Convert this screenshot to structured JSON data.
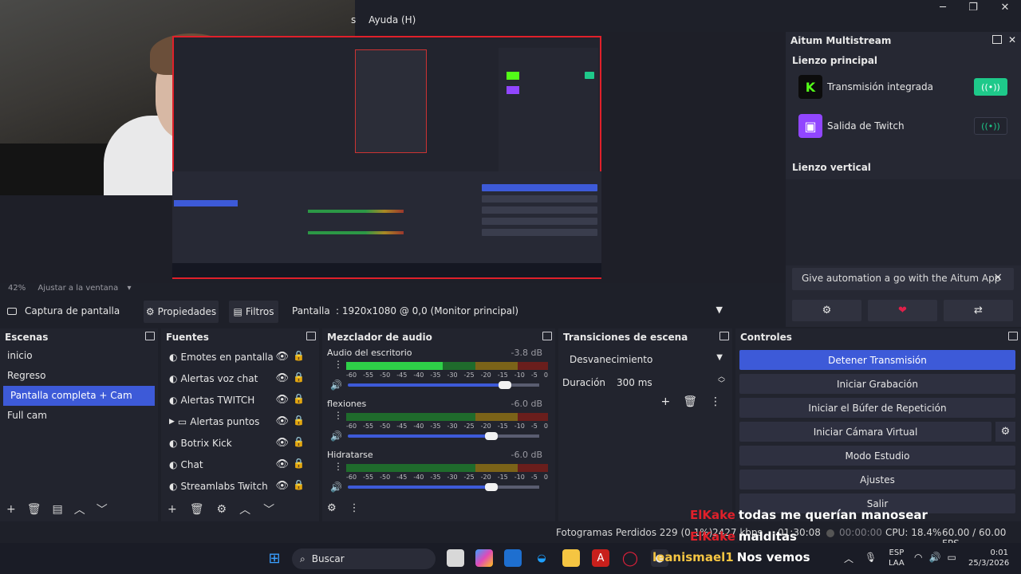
{
  "menubar": {
    "partial_item": "s",
    "help_label": "Ayuda (H)"
  },
  "window_controls": {
    "minimize": "─",
    "maximize": "❐",
    "close": "✕"
  },
  "preview": {
    "zoom_label": "42%",
    "fit_label": "Ajustar a la ventana"
  },
  "aitum": {
    "title": "Aitum Multistream",
    "main_canvas_label": "Lienzo principal",
    "outputs": [
      {
        "label": "Transmisión integrada",
        "icon": "kick-icon",
        "active": true
      },
      {
        "label": "Salida de Twitch",
        "icon": "twitch-icon",
        "active": false
      }
    ],
    "vertical_canvas_label": "Lienzo vertical",
    "ad_text": "Give automation a go with the Aitum App",
    "ad_close": "×",
    "colors": {
      "kick": "#53fc18",
      "twitch": "#9146ff",
      "active_toggle": "#1ec98a",
      "heart": "#e0204a"
    }
  },
  "source_toolbar": {
    "source_name": "Captura de pantalla",
    "properties_label": "Propiedades",
    "filters_label": "Filtros",
    "display_label": "Pantalla",
    "display_value": ": 1920x1080 @ 0,0 (Monitor principal)"
  },
  "scenes": {
    "title": "Escenas",
    "items": [
      "inicio",
      "Regreso",
      "Pantalla completa + Cam",
      "Full cam"
    ],
    "selected_index": 2
  },
  "sources": {
    "title": "Fuentes",
    "items": [
      {
        "label": "Emotes en pantalla",
        "type": "browser"
      },
      {
        "label": "Alertas voz chat",
        "type": "browser"
      },
      {
        "label": "Alertas TWITCH",
        "type": "browser"
      },
      {
        "label": "Alertas puntos",
        "type": "group"
      },
      {
        "label": "Botrix Kick",
        "type": "browser"
      },
      {
        "label": "Chat",
        "type": "browser"
      },
      {
        "label": "Streamlabs Twitch",
        "type": "browser"
      }
    ]
  },
  "mixer": {
    "title": "Mezclador de audio",
    "tick_labels": [
      "-60",
      "-55",
      "-50",
      "-45",
      "-40",
      "-35",
      "-30",
      "-25",
      "-20",
      "-15",
      "-10",
      "-5",
      "0"
    ],
    "channels": [
      {
        "name": "Audio del escritorio",
        "db": "-3.8 dB",
        "level": 0.48,
        "volume": 0.82
      },
      {
        "name": "flexiones",
        "db": "-6.0 dB",
        "level": 0.0,
        "volume": 0.75
      },
      {
        "name": "Hidratarse",
        "db": "-6.0 dB",
        "level": 0.0,
        "volume": 0.75
      }
    ]
  },
  "transitions": {
    "title": "Transiciones de escena",
    "selected": "Desvanecimiento",
    "duration_label": "Duración",
    "duration_value": "300 ms"
  },
  "controls": {
    "title": "Controles",
    "buttons": [
      "Detener Transmisión",
      "Iniciar Grabación",
      "Iniciar el Búfer de Repetición",
      "Iniciar Cámara Virtual",
      "Modo Estudio",
      "Ajustes",
      "Salir"
    ]
  },
  "status": {
    "dropped_frames": "Fotogramas Perdidos 229 (0.1%)",
    "bitrate": "2427 kbps",
    "stream_time": "01:30:08",
    "rec_time": "00:00:00",
    "cpu": "CPU: 18.4%",
    "fps": "60.00 / 60.00 FPS"
  },
  "chat_overlay": [
    {
      "user": "ElKake",
      "message": "todas me querían manosear"
    },
    {
      "user": "ElKake",
      "message": "malditas"
    },
    {
      "user": "leanismael1",
      "message": "Nos vemos"
    }
  ],
  "taskbar": {
    "search_placeholder": "Buscar",
    "lang_top": "ESP",
    "lang_bottom": "LAA",
    "time": "0:01",
    "date": "25/3/2026"
  }
}
